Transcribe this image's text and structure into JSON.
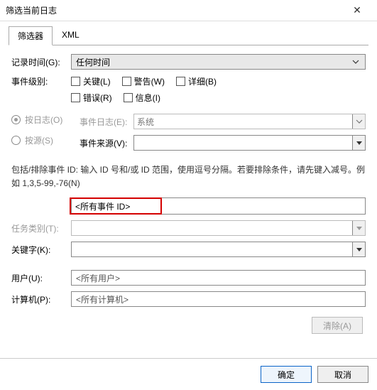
{
  "window": {
    "title": "筛选当前日志"
  },
  "tabs": {
    "filter": "筛选器",
    "xml": "XML"
  },
  "labels": {
    "recordTime": "记录时间(G):",
    "eventLevel": "事件级别:",
    "byLog": "按日志(O)",
    "bySource": "按源(S)",
    "eventLog": "事件日志(E):",
    "eventSource": "事件来源(V):",
    "hint": "包括/排除事件 ID: 输入 ID 号和/或 ID 范围，使用逗号分隔。若要排除条件，请先键入减号。例如 1,3,5-99,-76(N)",
    "taskCategory": "任务类别(T):",
    "keyword": "关键字(K):",
    "user": "用户(U):",
    "computer": "计算机(P):"
  },
  "values": {
    "recordTime": "任何时间",
    "eventLog": "系统",
    "eventIdPlaceholder": "<所有事件 ID>",
    "userPlaceholder": "<所有用户>",
    "computerPlaceholder": "<所有计算机>"
  },
  "checkboxes": {
    "critical": "关键(L)",
    "warning": "警告(W)",
    "verbose": "详细(B)",
    "error": "错误(R)",
    "info": "信息(I)"
  },
  "buttons": {
    "clear": "清除(A)",
    "ok": "确定",
    "cancel": "取消"
  }
}
